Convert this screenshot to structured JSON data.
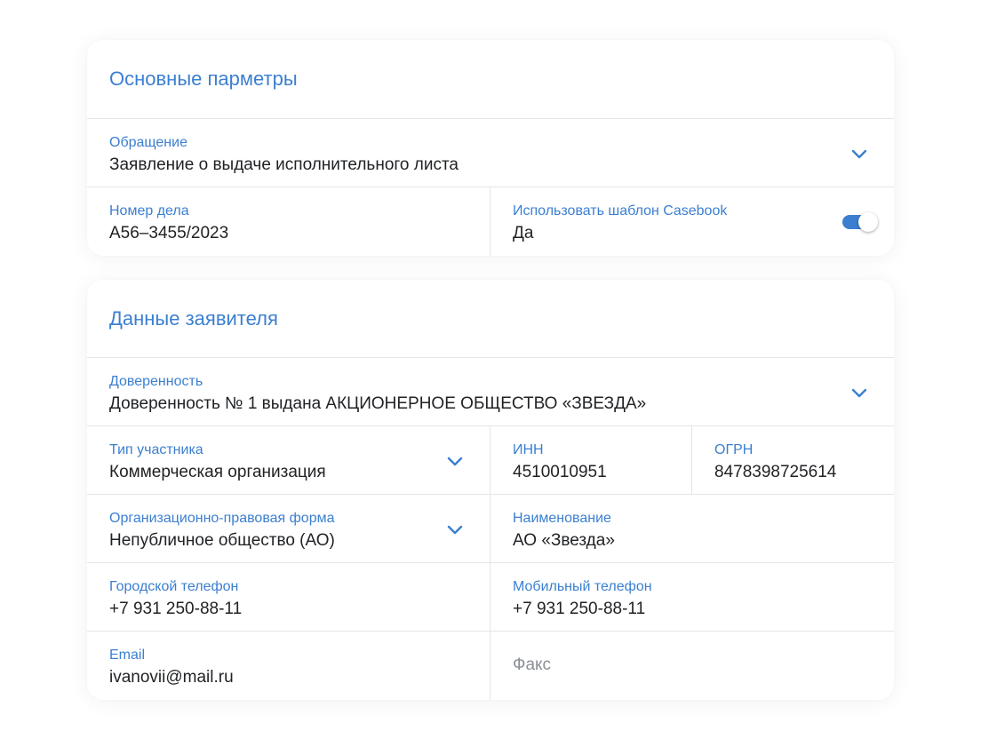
{
  "main_params": {
    "title": "Основные парметры",
    "appeal": {
      "label": "Обращение",
      "value": "Заявление о выдаче исполнительного листа"
    },
    "case_number": {
      "label": "Номер дела",
      "value": "А56–3455/2023"
    },
    "casebook_template": {
      "label": "Использовать шаблон Casebook",
      "value": "Да",
      "enabled": true
    }
  },
  "applicant": {
    "title": "Данные заявителя",
    "power_of_attorney": {
      "label": "Доверенность",
      "value": "Доверенность № 1 выдана АКЦИОНЕРНОЕ ОБЩЕСТВО «ЗВЕЗДА»"
    },
    "participant_type": {
      "label": "Тип участника",
      "value": "Коммерческая организация"
    },
    "inn": {
      "label": "ИНН",
      "value": "4510010951"
    },
    "ogrn": {
      "label": "ОГРН",
      "value": "8478398725614"
    },
    "legal_form": {
      "label": "Организационно-правовая форма",
      "value": "Непубличное общество (АО)"
    },
    "name": {
      "label": "Наименование",
      "value": "АО «Звезда»"
    },
    "city_phone": {
      "label": "Городской телефон",
      "value": "+7 931 250-88-11"
    },
    "mobile_phone": {
      "label": "Мобильный телефон",
      "value": "+7 931 250-88-11"
    },
    "email": {
      "label": "Email",
      "value": "ivanovii@mail.ru"
    },
    "fax": {
      "placeholder": "Факс"
    }
  },
  "colors": {
    "accent": "#3b7fd0",
    "text": "#1f2124",
    "placeholder": "#8b9096",
    "divider": "#e3e5e8"
  },
  "icons": {
    "dropdown": "chevron-down-icon"
  }
}
